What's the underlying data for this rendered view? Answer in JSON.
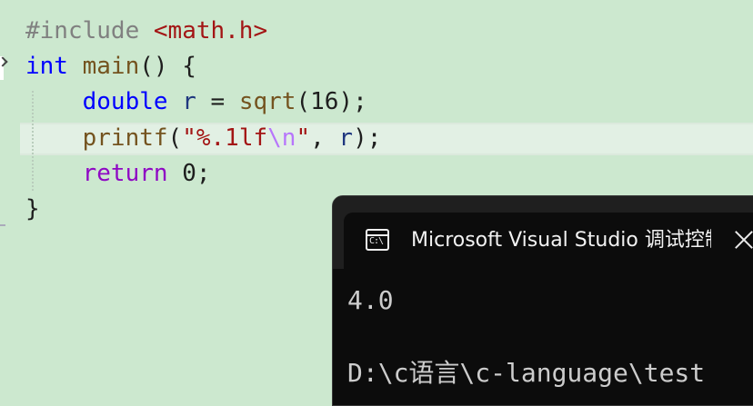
{
  "editor": {
    "colors": {
      "background": "#cce8cf",
      "keyword": "#0000ff",
      "control": "#8f08c4",
      "function": "#74531f",
      "string": "#a31515",
      "escape": "#b776fb",
      "variable": "#1f377f",
      "preprocessor": "#808080"
    },
    "lines": [
      {
        "tokens": [
          {
            "text": "#include ",
            "kind": "preprocessor"
          },
          {
            "text": "<math.h>",
            "kind": "string"
          }
        ]
      },
      {
        "tokens": [
          {
            "text": "int",
            "kind": "keyword"
          },
          {
            "text": " ",
            "kind": "plain"
          },
          {
            "text": "main",
            "kind": "function"
          },
          {
            "text": "() {",
            "kind": "plain"
          }
        ]
      },
      {
        "tokens": [
          {
            "text": "    ",
            "kind": "plain"
          },
          {
            "text": "double",
            "kind": "keyword"
          },
          {
            "text": " ",
            "kind": "plain"
          },
          {
            "text": "r",
            "kind": "variable"
          },
          {
            "text": " = ",
            "kind": "plain"
          },
          {
            "text": "sqrt",
            "kind": "function"
          },
          {
            "text": "(16);",
            "kind": "plain"
          }
        ]
      },
      {
        "tokens": [
          {
            "text": "    ",
            "kind": "plain"
          },
          {
            "text": "printf",
            "kind": "function"
          },
          {
            "text": "(",
            "kind": "plain"
          },
          {
            "text": "\"%.1lf",
            "kind": "string"
          },
          {
            "text": "\\n",
            "kind": "escape"
          },
          {
            "text": "\"",
            "kind": "string"
          },
          {
            "text": ", ",
            "kind": "plain"
          },
          {
            "text": "r",
            "kind": "variable"
          },
          {
            "text": ");",
            "kind": "plain"
          }
        ]
      },
      {
        "tokens": [
          {
            "text": "    ",
            "kind": "plain"
          },
          {
            "text": "return",
            "kind": "control"
          },
          {
            "text": " 0;",
            "kind": "plain"
          }
        ]
      },
      {
        "tokens": [
          {
            "text": "}",
            "kind": "plain"
          }
        ]
      }
    ]
  },
  "console": {
    "icon": "console-icon",
    "icon_glyph": "C:\\",
    "title": "Microsoft Visual Studio 调试控制台",
    "close_icon": "close-icon",
    "output_line": "4.0",
    "path_line": "D:\\c语言\\c-language\\test"
  }
}
